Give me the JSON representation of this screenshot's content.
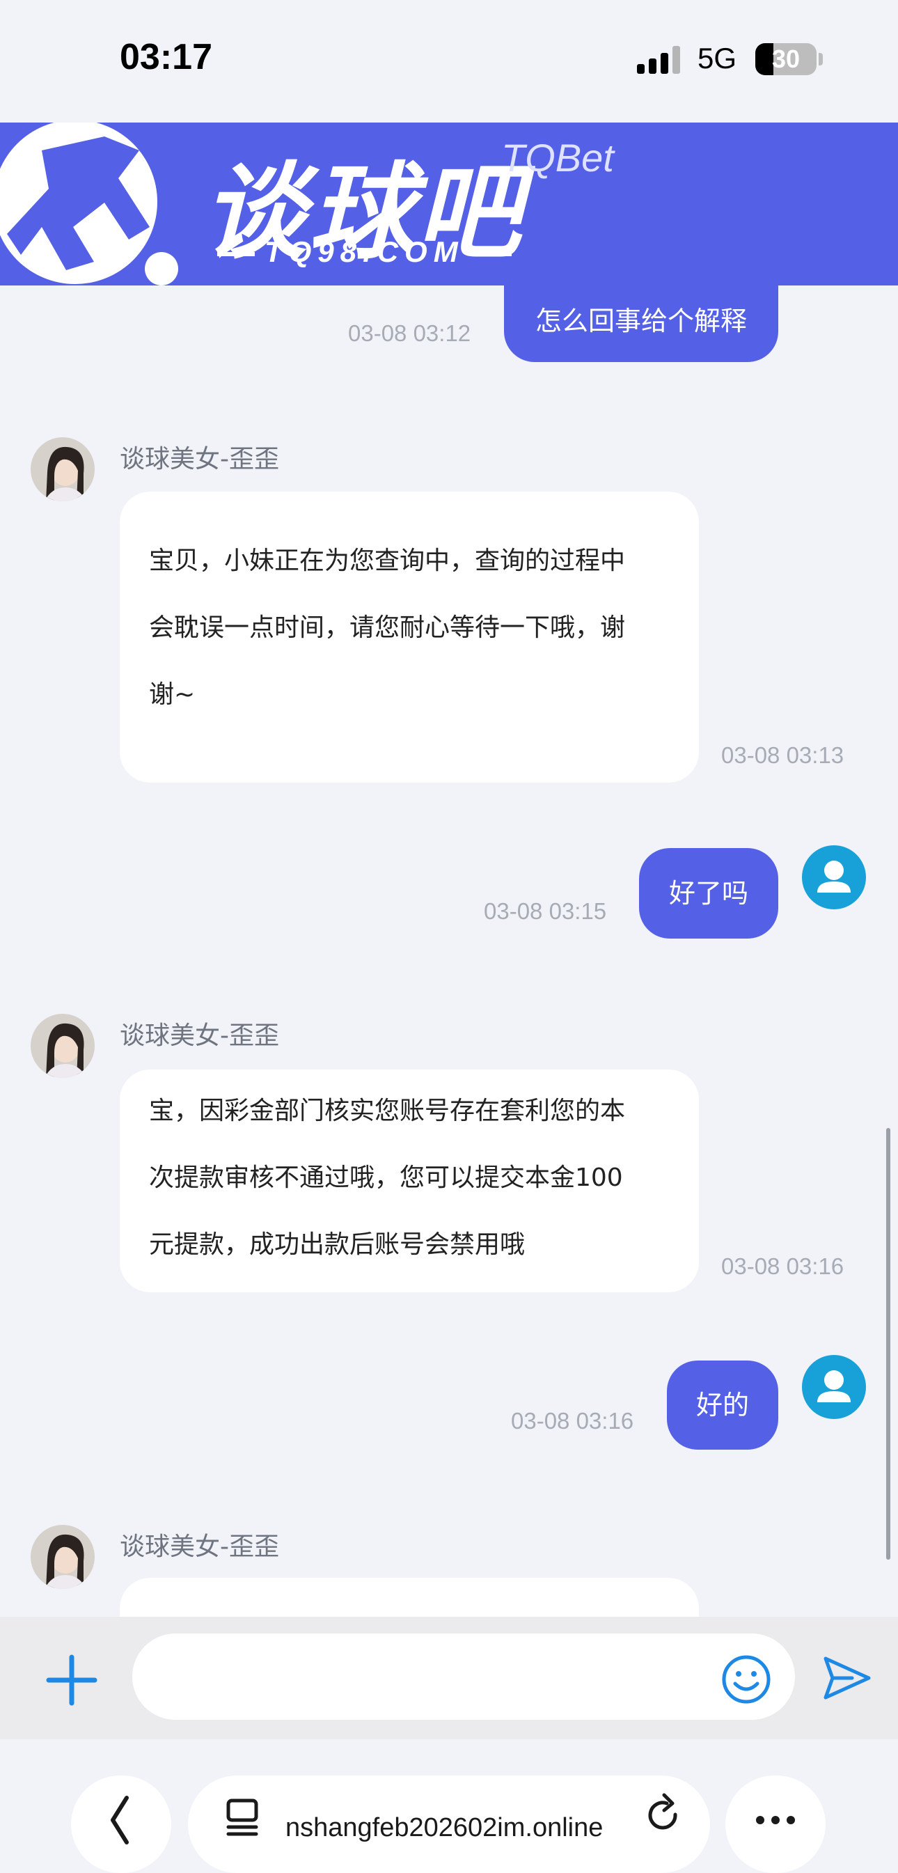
{
  "status_bar": {
    "time": "03:17",
    "network": "5G",
    "battery": "30",
    "battery_level": 0.3
  },
  "banner": {
    "brand_name": "谈球吧",
    "brand_en": "TQBet",
    "domain": "TQ98.COM"
  },
  "messages": [
    {
      "from": "user",
      "text": "怎么回事给个解释",
      "time": "03-08 03:12"
    },
    {
      "from": "agent",
      "sender": "谈球美女-歪歪",
      "lines": [
        "宝贝，小妹正在为您查询中，查询的过程中",
        "会耽误一点时间，请您耐心等待一下哦，谢",
        "谢~"
      ],
      "time": "03-08 03:13"
    },
    {
      "from": "user",
      "text": "好了吗",
      "time": "03-08 03:15"
    },
    {
      "from": "agent",
      "sender": "谈球美女-歪歪",
      "lines": [
        "宝，因彩金部门核实您账号存在套利您的本",
        "次提款审核不通过哦，您可以提交本金100",
        "元提款，成功出款后账号会禁用哦"
      ],
      "time": "03-08 03:16"
    },
    {
      "from": "user",
      "text": "好的",
      "time": "03-08 03:16"
    },
    {
      "from": "agent",
      "sender": "谈球美女-歪歪",
      "lines": [],
      "time": ""
    }
  ],
  "input": {
    "placeholder": ""
  },
  "browser": {
    "url": "nshangfeb202602im.online"
  },
  "colors": {
    "accent": "#5461e6",
    "user_avatar": "#18a1d8",
    "banner": "#5460e6",
    "icon_blue": "#1e88e5"
  }
}
